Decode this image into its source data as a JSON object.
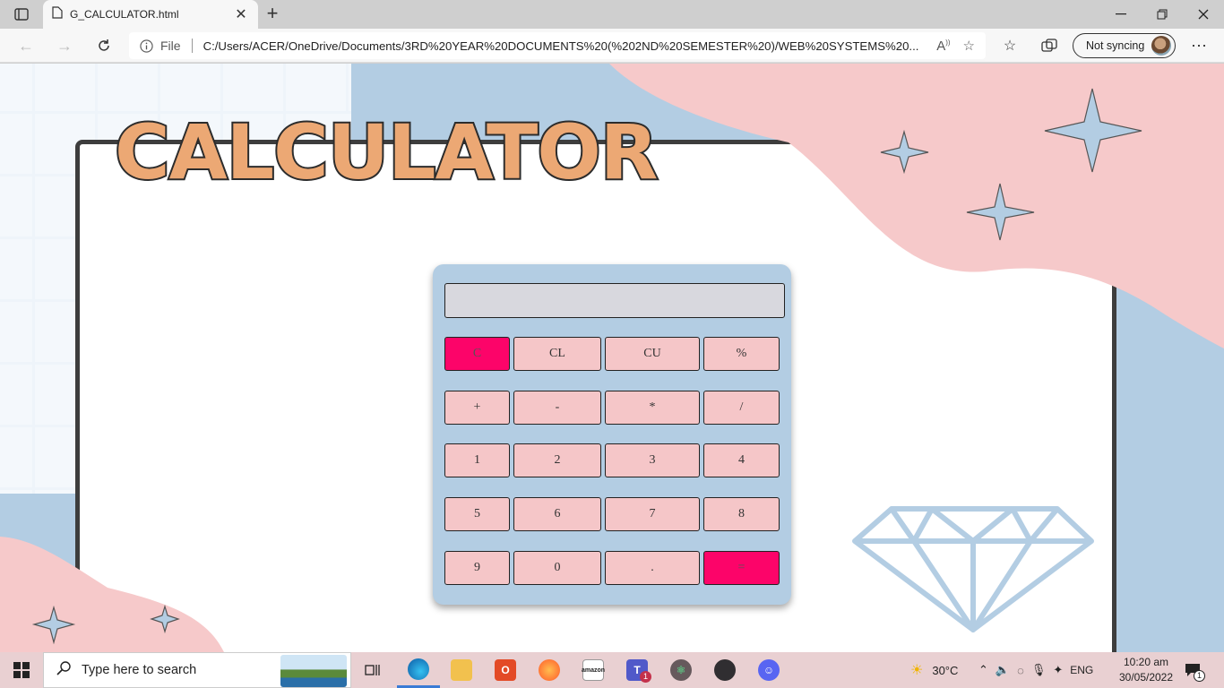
{
  "browser": {
    "tab_title": "G_CALCULATOR.html",
    "address_label": "File",
    "url": "C:/Users/ACER/OneDrive/Documents/3RD%20YEAR%20DOCUMENTS%20(%202ND%20SEMESTER%20)/WEB%20SYSTEMS%20...",
    "sync_label": "Not syncing",
    "new_tab": "+",
    "close_tab": "✕"
  },
  "page": {
    "title": "CALCULATOR",
    "display_value": ""
  },
  "calculator": {
    "rows": [
      [
        "C",
        "CL",
        "CU",
        "%"
      ],
      [
        "+",
        "-",
        "*",
        "/"
      ],
      [
        "1",
        "2",
        "3",
        "4"
      ],
      [
        "5",
        "6",
        "7",
        "8"
      ],
      [
        "9",
        "0",
        ".",
        "="
      ]
    ],
    "highlight_color": "#fc0469",
    "key_color": "#f5c6c8"
  },
  "taskbar": {
    "search_placeholder": "Type here to search",
    "weather": "30°C",
    "language": "ENG",
    "time": "10:20 am",
    "date": "30/05/2022",
    "notification_count": "1",
    "teams_badge": "1"
  },
  "colors": {
    "background_blue": "#b3cde3",
    "blob_pink": "#f6c9ca",
    "title_fill": "#eca874"
  }
}
